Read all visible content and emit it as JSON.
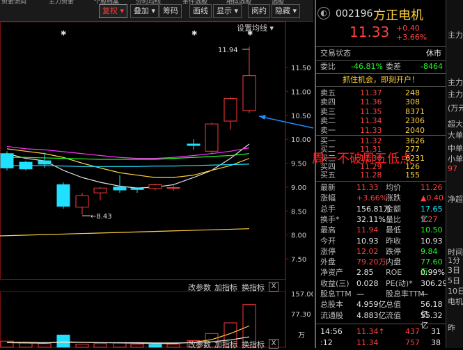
{
  "toolbar": {
    "top_cut": [
      "资金流向",
      "主力资金",
      "个股档案",
      "分时均线",
      "条件选股",
      "相似选股",
      "选股"
    ],
    "buttons": [
      "复权",
      "叠加",
      "筹码",
      "画线",
      "显示",
      "阅约",
      "隐藏"
    ],
    "fuquan_arrow": "▾",
    "xian_arrow": "▾",
    "yin_arrow": "▾"
  },
  "chart": {
    "settings_label": "设置均线",
    "settings_arrow": "▾",
    "price_axis": [
      "11.50",
      "11.00",
      "10.50",
      "10.00",
      "9.50",
      "9.00",
      "8.50",
      "8.00",
      "7.50"
    ],
    "high_label": "11.94",
    "low_label": "8.43",
    "star": "✱",
    "vol_axis": [
      "157.00",
      "77.30"
    ],
    "vol_unit": "万",
    "tool_labels": [
      "改参数",
      "加指标",
      "换指标"
    ],
    "tool_close": "X",
    "bottom_tools": [
      "改参数",
      "加指标",
      "换指标"
    ],
    "candles": [
      {
        "o": 9.7,
        "c": 9.4,
        "h": 9.75,
        "l": 9.35
      },
      {
        "o": 9.52,
        "c": 9.38,
        "h": 9.55,
        "l": 9.35
      },
      {
        "o": 9.55,
        "c": 9.48,
        "h": 9.72,
        "l": 9.4
      },
      {
        "o": 9.05,
        "c": 8.6,
        "h": 9.1,
        "l": 8.55
      },
      {
        "o": 8.58,
        "c": 8.82,
        "h": 8.88,
        "l": 8.43
      },
      {
        "o": 8.88,
        "c": 8.98,
        "h": 9.0,
        "l": 8.72
      },
      {
        "o": 9.0,
        "c": 8.94,
        "h": 9.25,
        "l": 8.88
      },
      {
        "o": 8.97,
        "c": 8.95,
        "h": 9.0,
        "l": 8.88
      },
      {
        "o": 8.97,
        "c": 9.05,
        "h": 9.07,
        "l": 8.93
      },
      {
        "o": 8.98,
        "c": 8.99,
        "h": 9.04,
        "l": 8.92
      },
      {
        "o": 9.9,
        "c": 9.87,
        "h": 10.0,
        "l": 9.78
      },
      {
        "o": 9.75,
        "c": 10.32,
        "h": 10.35,
        "l": 9.7
      },
      {
        "o": 10.38,
        "c": 10.85,
        "h": 10.88,
        "l": 10.2
      },
      {
        "o": 10.6,
        "c": 11.33,
        "h": 11.94,
        "l": 10.55
      }
    ],
    "volumes": [
      20,
      14,
      12,
      40,
      10,
      12,
      14,
      10,
      9,
      10,
      22,
      45,
      80,
      140
    ],
    "vol_colors": [
      "up",
      "down",
      "up",
      "cyan",
      "up",
      "up",
      "up",
      "up",
      "cyan",
      "up",
      "up",
      "up",
      "up",
      "up"
    ]
  },
  "stock": {
    "code": "002196",
    "name": "方正电机",
    "price": "11.33",
    "change": "+0.40",
    "change_pct": "+3.66%",
    "icon": "自"
  },
  "status": {
    "label": "交易状态",
    "value": "休市"
  },
  "weibi": {
    "label1": "委比",
    "val1": "-46.81%",
    "label2": "委差",
    "val2": "-8464"
  },
  "promo": "抓住机会，即刻开户！",
  "sell": [
    {
      "label": "卖五",
      "price": "11.37",
      "vol": "248"
    },
    {
      "label": "卖四",
      "price": "11.36",
      "vol": "308"
    },
    {
      "label": "卖三",
      "price": "11.35",
      "vol": "8371"
    },
    {
      "label": "卖二",
      "price": "11.34",
      "vol": "2306"
    },
    {
      "label": "卖一",
      "price": "11.33",
      "vol": "2040"
    }
  ],
  "buy": [
    {
      "label": "买一",
      "price": "11.32",
      "vol": "3626"
    },
    {
      "label": "买二",
      "price": "11.31",
      "vol": "277"
    },
    {
      "label": "买三",
      "price": "11.30",
      "vol": "6231"
    },
    {
      "label": "买四",
      "price": "11.29",
      "vol": "126"
    },
    {
      "label": "买五",
      "price": "11.28",
      "vol": "155"
    }
  ],
  "stats": [
    {
      "l1": "最新",
      "v1": "11.33",
      "c1": "red",
      "l2": "均价",
      "v2": "11.26",
      "c2": "red"
    },
    {
      "l1": "涨幅",
      "v1": "+3.66%",
      "c1": "red",
      "l2": "涨跌",
      "v2": "▲0.40",
      "c2": "red"
    },
    {
      "l1": "总手",
      "v1": "156.81万",
      "c1": "wht",
      "l2": "金额",
      "v2": "17.65亿",
      "c2": "cyan"
    },
    {
      "l1": "换手*",
      "v1": "32.11%",
      "c1": "wht",
      "l2": "量比",
      "v2": "3.27",
      "c2": "red"
    },
    {
      "l1": "最高",
      "v1": "11.94",
      "c1": "red",
      "l2": "最低",
      "v2": "10.50",
      "c2": "green"
    },
    {
      "l1": "今开",
      "v1": "10.93",
      "c1": "wht",
      "l2": "昨收",
      "v2": "10.93",
      "c2": "wht"
    },
    {
      "l1": "涨停",
      "v1": "12.02",
      "c1": "red",
      "l2": "跌停",
      "v2": "9.84",
      "c2": "green"
    },
    {
      "l1": "外盘",
      "v1": "79.20万",
      "c1": "red",
      "l2": "内盘",
      "v2": "77.60万",
      "c2": "green"
    },
    {
      "l1": "净资产",
      "v1": "2.85",
      "c1": "wht",
      "l2": "ROE",
      "v2": "0.99%",
      "c2": "wht"
    },
    {
      "l1": "收益(三)",
      "v1": "0.028",
      "c1": "wht",
      "l2": "PE(动)*",
      "v2": "306.29",
      "c2": "wht"
    },
    {
      "l1": "股息TTM",
      "v1": "—",
      "c1": "wht",
      "l2": "股息率TTM",
      "v2": "—",
      "c2": "wht"
    },
    {
      "l1": "总股本",
      "v1": "4.959亿",
      "c1": "wht",
      "l2": "总值",
      "v2": "56.18亿",
      "c2": "wht"
    },
    {
      "l1": "流通股",
      "v1": "4.883亿",
      "c1": "wht",
      "l2": "流值",
      "v2": "55.32亿",
      "c2": "wht"
    }
  ],
  "ticks": [
    {
      "time": "14:56",
      "price": "11.34",
      "arrow": "↑",
      "vol": "437",
      "n": "31"
    },
    {
      "time": ":12",
      "price": "11.34",
      "arrow": "",
      "vol": "757",
      "n": "38"
    }
  ],
  "far_right": [
    "主力",
    "主力",
    "主力",
    "(万元",
    "超大",
    "大单",
    "中单",
    "小单",
    "97",
    "净超",
    "时间",
    "1分",
    "3日",
    "5日",
    "10日",
    "电机",
    "昨"
  ],
  "annotation": "周一不破周五低点"
}
